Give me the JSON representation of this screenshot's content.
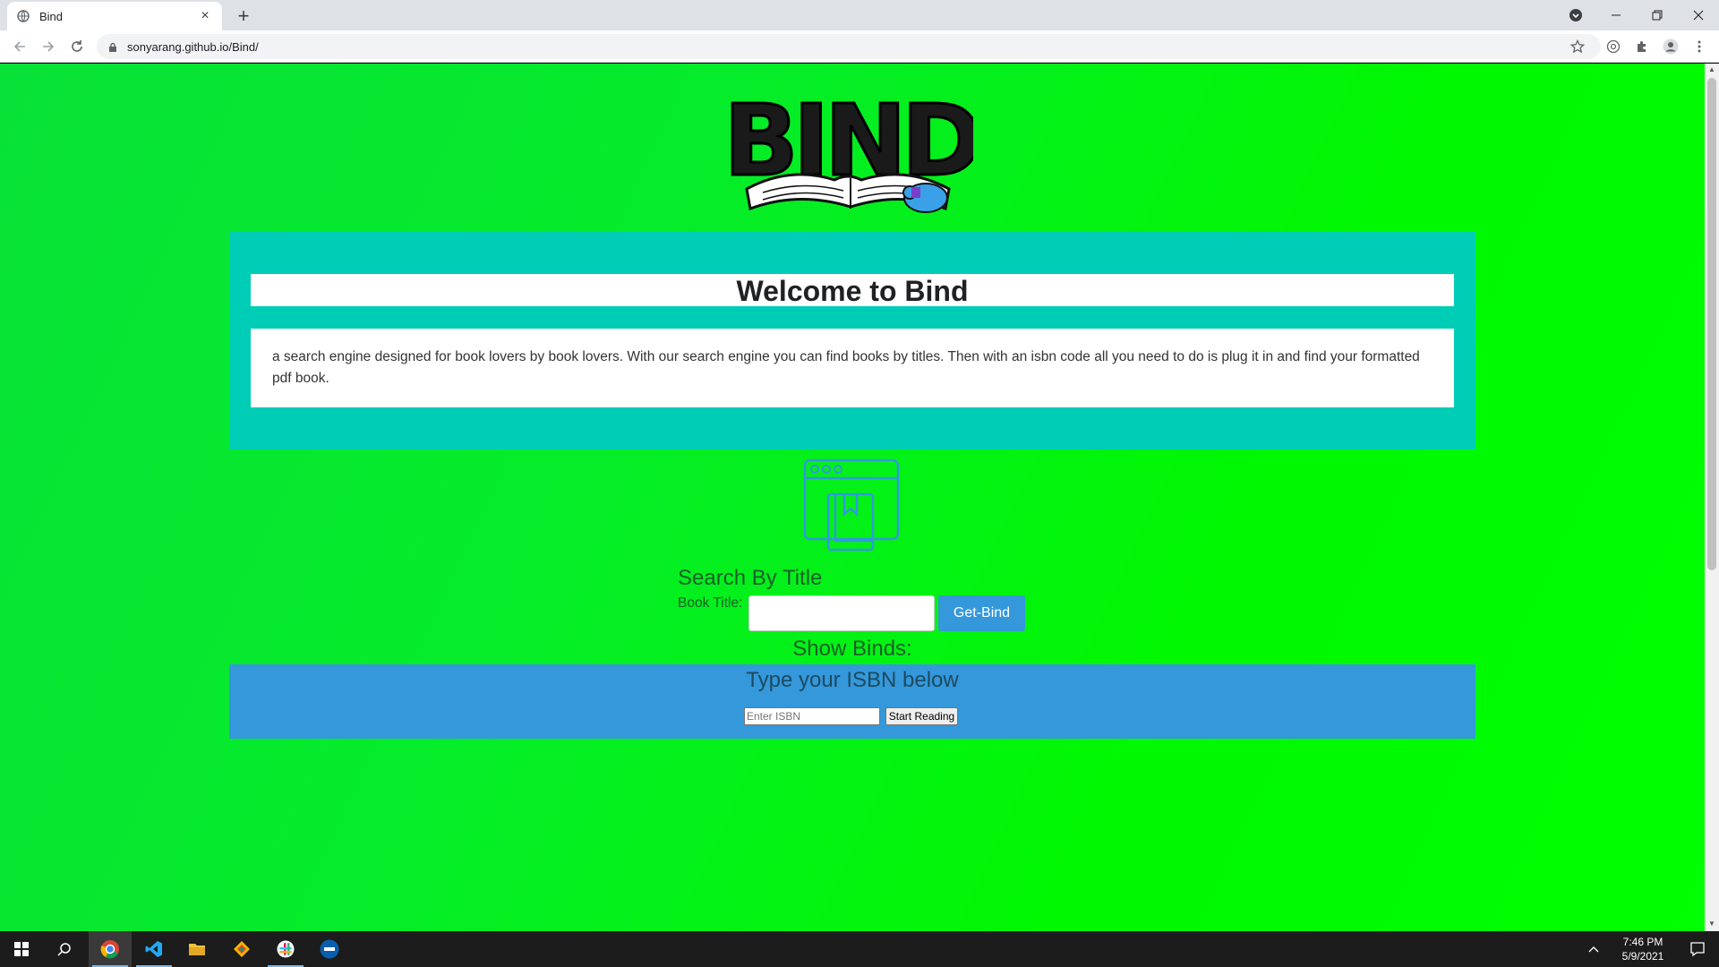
{
  "browser": {
    "tab_title": "Bind",
    "tab_close": "×",
    "new_tab": "+",
    "url": "sonyarang.github.io/Bind/"
  },
  "page": {
    "logo_text": "BIND",
    "welcome_title": "Welcome to Bind",
    "welcome_description": "a search engine designed for book lovers by book lovers. With our search engine you can find books by titles. Then with an isbn code all you need to do is plug it in and find your formatted pdf book.",
    "search_heading": "Search By Title",
    "book_title_label": "Book Title:",
    "book_title_value": "",
    "get_bind_button": "Get-Bind",
    "show_binds_label": "Show Binds:",
    "isbn_heading": "Type your ISBN below",
    "isbn_placeholder": "Enter ISBN",
    "start_reading_button": "Start Reading"
  },
  "taskbar": {
    "time": "7:46 PM",
    "date": "5/9/2021"
  },
  "colors": {
    "welcome_panel": "#00cdb5",
    "isbn_panel": "#3498db",
    "get_bind_button": "#3498db",
    "page_gradient_start": "#08e238",
    "page_gradient_end": "#00ff00"
  }
}
